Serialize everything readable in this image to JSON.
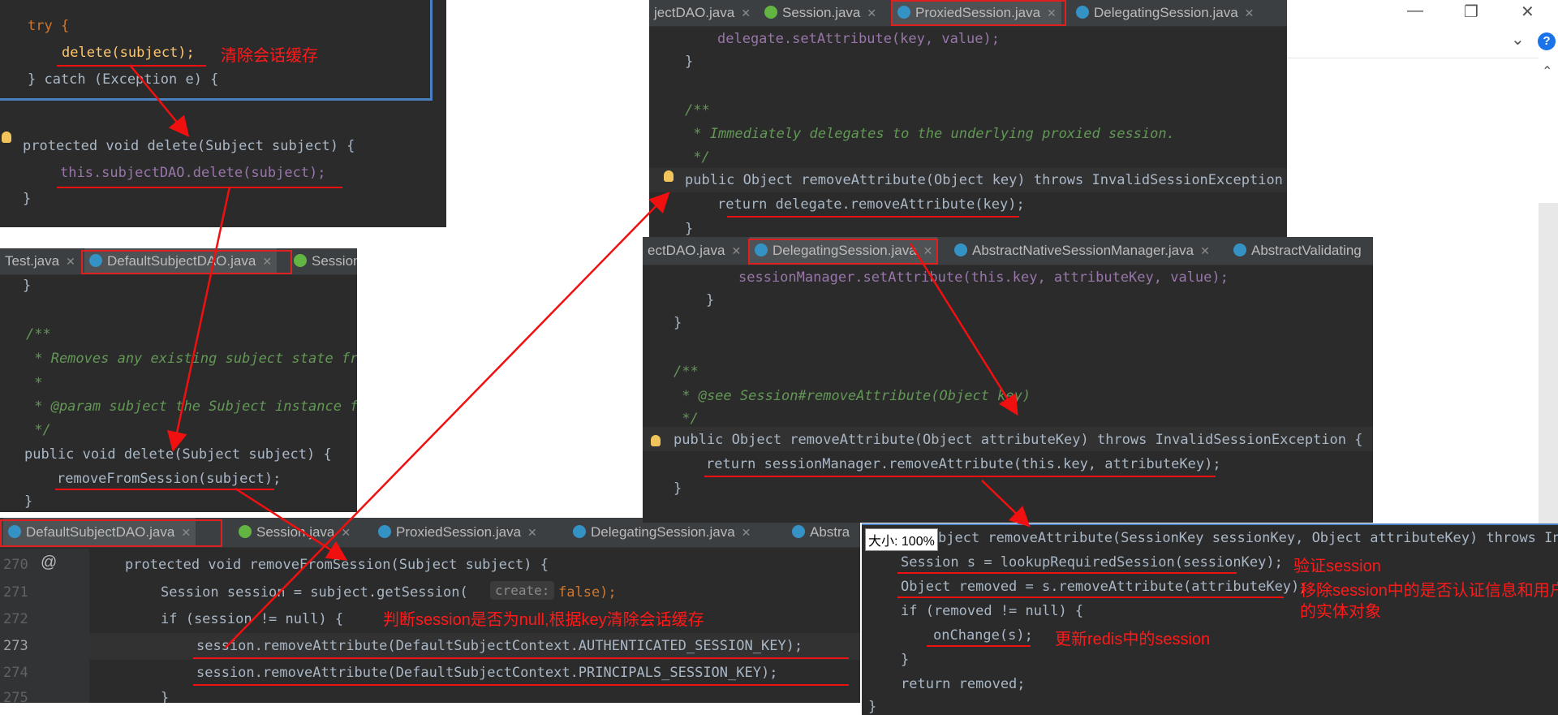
{
  "panel1": {
    "lines": [
      "try {",
      "delete(subject);",
      "} catch (Exception e) {",
      "protected void delete(Subject subject) {",
      "this.subjectDAO.delete(subject);",
      "}"
    ],
    "note": "清除会话缓存"
  },
  "panel2": {
    "tabs": [
      "Test.java",
      "DefaultSubjectDAO.java",
      "Session"
    ],
    "lines": [
      "}",
      "/**",
      " * Removes any existing subject state fro",
      " *",
      " * @param subject the Subject instance fo",
      " */",
      "public void delete(Subject subject) {",
      "removeFromSession(subject);",
      "}"
    ]
  },
  "panel3": {
    "tabs": [
      "DefaultSubjectDAO.java",
      "Session.java",
      "ProxiedSession.java",
      "DelegatingSession.java",
      "Abstra"
    ],
    "line_numbers": [
      "270",
      "271",
      "272",
      "273",
      "274",
      "275"
    ],
    "lines": [
      "protected void removeFromSession(Subject subject) {",
      "Session session = subject.getSession(",
      "create:",
      "false);",
      "if (session != null) {",
      "session.removeAttribute(DefaultSubjectContext.AUTHENTICATED_SESSION_KEY);",
      "session.removeAttribute(DefaultSubjectContext.PRINCIPALS_SESSION_KEY);",
      "}"
    ],
    "note": "判断session是否为null,根据key清除会话缓存"
  },
  "panel4": {
    "tabs": [
      "jectDAO.java",
      "Session.java",
      "ProxiedSession.java",
      "DelegatingSession.java"
    ],
    "lines": [
      "delegate.setAttribute(key, value);",
      "}",
      "/**",
      " * Immediately delegates to the underlying proxied session.",
      " */",
      "public Object removeAttribute(Object key) throws InvalidSessionException {",
      "return delegate.removeAttribute(key);",
      "}"
    ]
  },
  "panel5": {
    "tabs": [
      "ectDAO.java",
      "DelegatingSession.java",
      "AbstractNativeSessionManager.java",
      "AbstractValidating"
    ],
    "lines": [
      "sessionManager.setAttribute(this.key, attributeKey, value);",
      "}",
      "}",
      "/**",
      " * @see Session#removeAttribute(Object key)",
      " */",
      "public Object removeAttribute(Object attributeKey) throws InvalidSessionException {",
      "return sessionManager.removeAttribute(this.key, attributeKey);",
      "}"
    ]
  },
  "panel6": {
    "zoom_label": "大小: 100%",
    "lines": [
      "bject removeAttribute(SessionKey sessionKey, Object attributeKey) throws Inval",
      "Session s = lookupRequiredSession(sessionKey);",
      "Object removed = s.removeAttribute(attributeKey);",
      "if (removed != null) {",
      "onChange(s);",
      "}",
      "return removed;",
      "}"
    ],
    "notes": {
      "validate": "验证session",
      "remove_line1": "移除session中的是否认证信息和用户",
      "remove_line2": "的实体对象",
      "update": "更新redis中的session"
    }
  },
  "window_controls": {
    "minimize": "—",
    "restore": "❐",
    "close": "✕",
    "chevron": "⌄",
    "help": "?"
  },
  "colors": {
    "editor_bg": "#2b2b2b",
    "annotation_red": "#ff1a1a",
    "keyword": "#cc7832",
    "method": "#ffc66d",
    "field": "#9876aa",
    "comment": "#629755"
  }
}
